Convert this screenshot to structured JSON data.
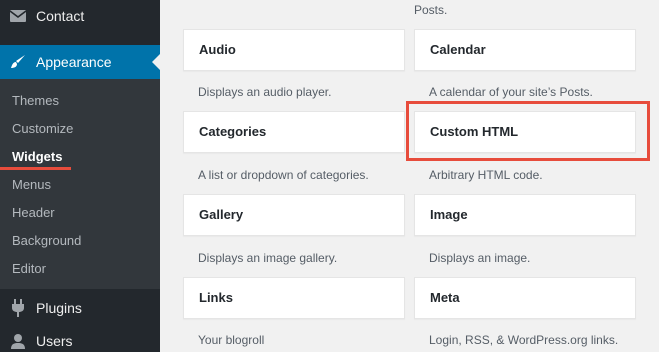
{
  "sidebar": {
    "contact": "Contact",
    "appearance": "Appearance",
    "submenu": [
      "Themes",
      "Customize",
      "Widgets",
      "Menus",
      "Header",
      "Background",
      "Editor"
    ],
    "plugins": "Plugins",
    "users": "Users"
  },
  "widgets": {
    "top_desc": "Posts.",
    "audio": {
      "title": "Audio",
      "desc": "Displays an audio player."
    },
    "calendar": {
      "title": "Calendar",
      "desc": "A calendar of your site’s Posts."
    },
    "categories": {
      "title": "Categories",
      "desc": "A list or dropdown of categories."
    },
    "custom_html": {
      "title": "Custom HTML",
      "desc": "Arbitrary HTML code."
    },
    "gallery": {
      "title": "Gallery",
      "desc": "Displays an image gallery."
    },
    "image": {
      "title": "Image",
      "desc": "Displays an image."
    },
    "links": {
      "title": "Links",
      "desc": "Your blogroll"
    },
    "meta": {
      "title": "Meta",
      "desc": "Login, RSS, & WordPress.org links."
    }
  },
  "colors": {
    "sidebar_bg": "#23282d",
    "submenu_bg": "#32373c",
    "accent": "#0073aa",
    "highlight": "#e74c3c"
  }
}
